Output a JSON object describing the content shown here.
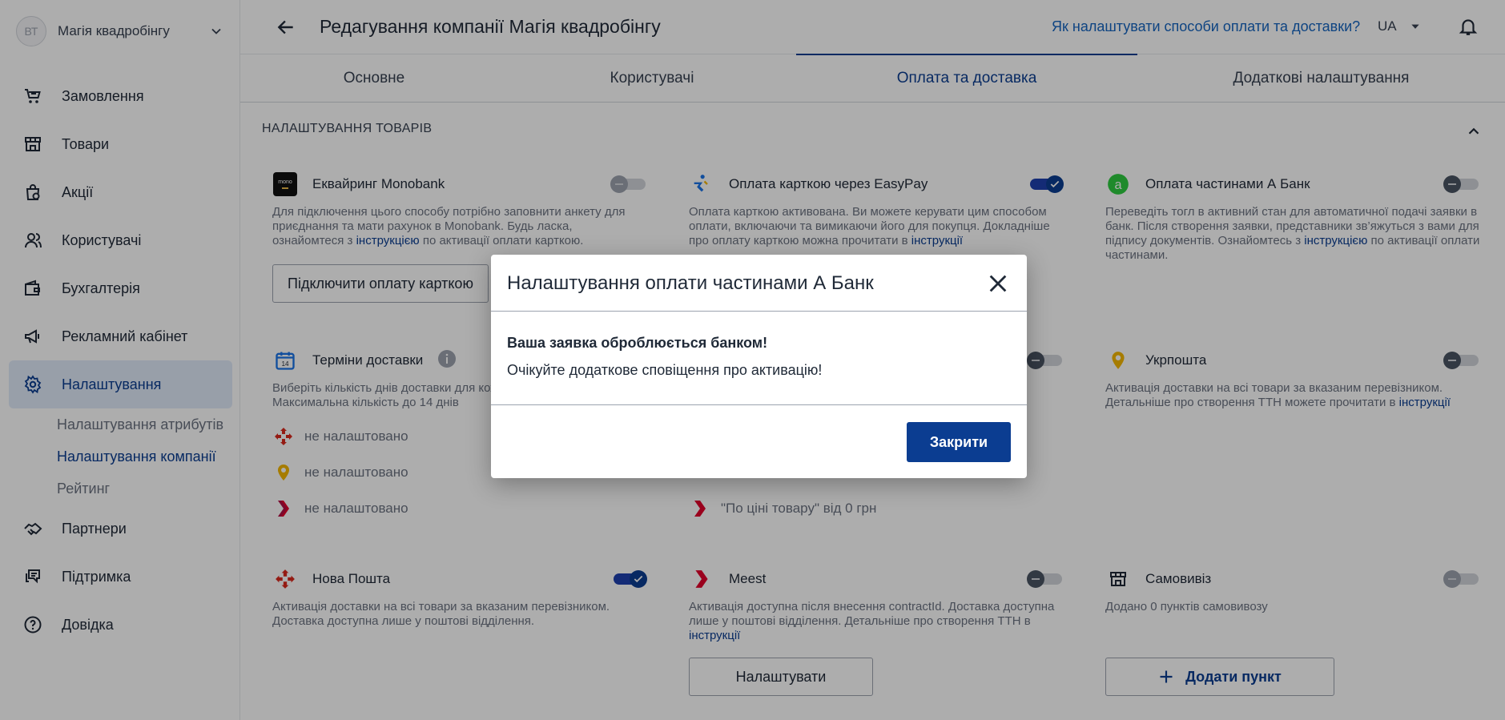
{
  "sidebar": {
    "avatar_initials": "ВТ",
    "company_name": "Магія квадробінгу",
    "nav": [
      {
        "label": "Замовлення",
        "icon": "cart-icon"
      },
      {
        "label": "Товари",
        "icon": "store-icon"
      },
      {
        "label": "Акції",
        "icon": "promo-bag-icon"
      },
      {
        "label": "Користувачі",
        "icon": "users-icon"
      },
      {
        "label": "Бухгалтерія",
        "icon": "wallet-icon"
      },
      {
        "label": "Рекламний кабінет",
        "icon": "megaphone-icon"
      },
      {
        "label": "Налаштування",
        "icon": "gear-icon"
      },
      {
        "label": "Партнери",
        "icon": "handshake-icon"
      },
      {
        "label": "Підтримка",
        "icon": "chat-icon"
      },
      {
        "label": "Довідка",
        "icon": "help-circle-icon"
      }
    ],
    "subnav": [
      {
        "label": "Налаштування атрибутів"
      },
      {
        "label": "Налаштування компанії"
      },
      {
        "label": "Рейтинг"
      }
    ]
  },
  "header": {
    "title": "Редагування компанії Магія квадробінгу",
    "help_link": "Як налаштувати способи оплати та доставки?",
    "language": "UA"
  },
  "tabs": [
    {
      "label": "Основне"
    },
    {
      "label": "Користувачі"
    },
    {
      "label": "Оплата та доставка"
    },
    {
      "label": "Додаткові налаштування"
    }
  ],
  "section": {
    "title": "НАЛАШТУВАННЯ ТОВАРІВ"
  },
  "cards": {
    "monobank": {
      "title": "Еквайринг Monobank",
      "logo_text": "mono",
      "toggle": "off-disabled",
      "desc1": "Для підключення цього способу потрібно заповнити анкету для приєднання та мати рахунок в Monobank. Будь ласка, ознайомтеся з ",
      "link": "інструкцією",
      "desc2": " по активації оплати карткою.",
      "button": "Підключити оплату карткою"
    },
    "easypay": {
      "title": "Оплата карткою через EasyPay",
      "toggle": "on",
      "desc1": "Оплата карткою активована. Ви можете керувати цим способом оплати, включаючи та вимикаючи його для покупця. Докладніше про оплату карткою можна прочитати в ",
      "link": "інструкції"
    },
    "abank": {
      "title": "Оплата частинами А Банк",
      "toggle": "off",
      "desc1": "Переведіть тогл в активний стан для автоматичної подачі заявки в банк. Після створення заявки, представники зв’яжуться з вами для підпису документів. Ознайомтесь з ",
      "link": "інструкцією",
      "desc2": " по активації оплати частинами."
    },
    "delivery_terms": {
      "title": "Терміни доставки",
      "desc": "Виберіть кількість днів доставки для кожного перевізника. Максимальна кількість до 14 днів",
      "rows": [
        {
          "icon": "nova-poshta-icon",
          "text": "не налаштовано"
        },
        {
          "icon": "ukrposhta-icon",
          "text": "не налаштовано"
        },
        {
          "icon": "meest-icon",
          "text": "не налаштовано"
        }
      ]
    },
    "middle_delivery": {
      "toggle": "off",
      "row": {
        "icon": "meest-icon",
        "text": "\"По ціні товару\" від 0 грн"
      }
    },
    "ukrposhta": {
      "title": "Укрпошта",
      "toggle": "off",
      "desc1": "Активація доставки на всі товари за вказаним перевізником. Детальніше про створення ТТН можете прочитати в ",
      "link": "інструкції"
    },
    "nova_poshta": {
      "title": "Нова Пошта",
      "toggle": "on",
      "desc": "Активація доставки на всі товари за вказаним перевізником. Доставка доступна лише у поштові відділення."
    },
    "meest": {
      "title": "Meest",
      "toggle": "off",
      "desc1": "Активація доступна після внесення contractId. Доставка доступна лише у поштові відділення. Детальніше про створення ТТН в ",
      "link": "інструкції",
      "button": "Налаштувати"
    },
    "pickup": {
      "title": "Самовивіз",
      "toggle": "off-disabled",
      "desc": "Додано 0 пунктів самовивозу",
      "button": "Додати пункт"
    }
  },
  "modal": {
    "title": "Налаштування оплати частинами А Банк",
    "message1": "Ваша заявка оброблюється банком!",
    "message2": "Очікуйте додаткове сповіщення про активацію!",
    "button": "Закрити"
  },
  "colors": {
    "primary": "#0b3d91",
    "link": "#1565c0",
    "active_nav_bg": "#e1ebf9",
    "nova_poshta_red": "#da291c",
    "ukrposhta_yellow": "#f5b700",
    "meest_red": "#e4002b",
    "abank_green": "#2ecc40",
    "easypay_blue": "#1a73e8"
  }
}
